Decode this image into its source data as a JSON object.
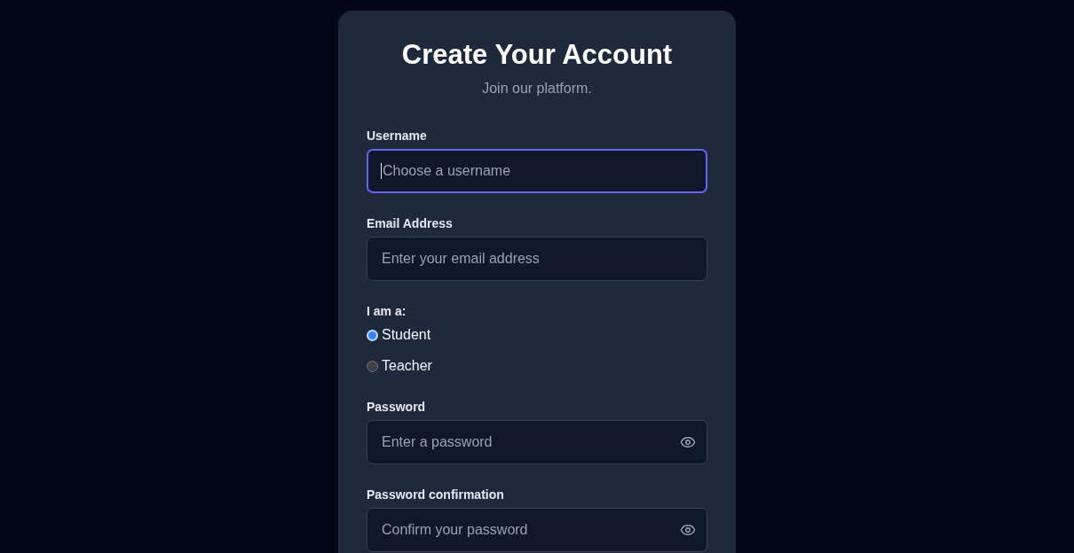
{
  "header": {
    "title": "Create Your Account",
    "subtitle": "Join our platform."
  },
  "fields": [
    {
      "kind": "text",
      "label": "Username",
      "placeholder": "Choose a username",
      "focused": true
    },
    {
      "kind": "text",
      "label": "Email Address",
      "placeholder": "Enter your email address",
      "focused": false
    },
    {
      "kind": "radio",
      "label": "I am a:",
      "options": [
        {
          "label": "Student",
          "selected": true
        },
        {
          "label": "Teacher",
          "selected": false
        }
      ]
    },
    {
      "kind": "password",
      "label": "Password",
      "placeholder": "Enter a password",
      "focused": false
    },
    {
      "kind": "password",
      "label": "Password confirmation",
      "placeholder": "Confirm your password",
      "focused": false
    }
  ]
}
